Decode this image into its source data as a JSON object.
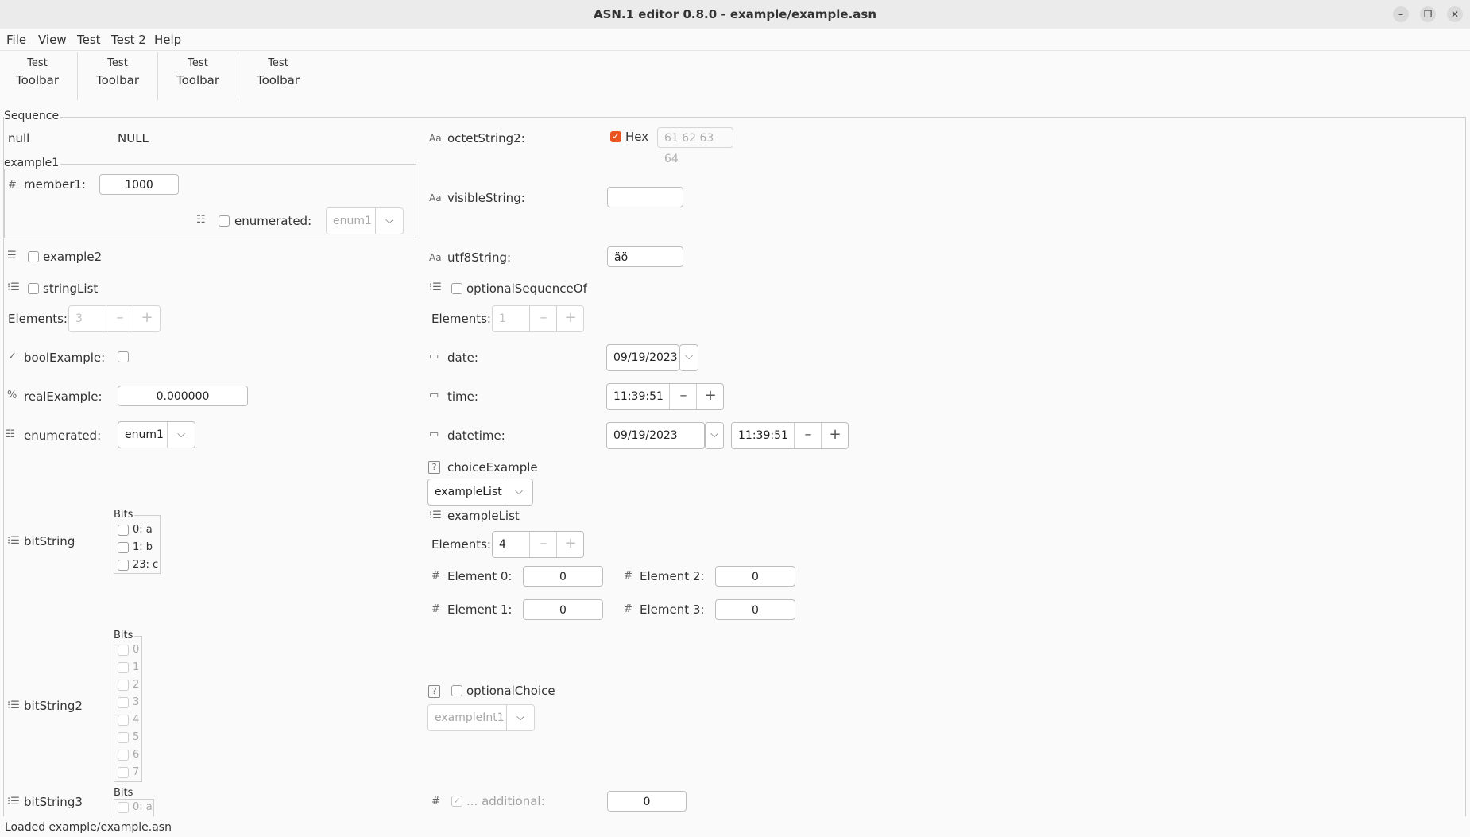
{
  "window": {
    "title": "ASN.1 editor 0.8.0 - example/example.asn",
    "buttons": [
      "minimize-icon",
      "restore-icon",
      "close-icon"
    ]
  },
  "menu": [
    {
      "label": "File"
    },
    {
      "label": "View"
    },
    {
      "label": "Test"
    },
    {
      "label": "Test 2"
    },
    {
      "label": "Help"
    }
  ],
  "toolbar": [
    {
      "top": "Test",
      "bottom": "Toolbar"
    },
    {
      "top": "Test",
      "bottom": "Toolbar"
    },
    {
      "top": "Test",
      "bottom": "Toolbar"
    },
    {
      "top": "Test",
      "bottom": "Toolbar"
    }
  ],
  "sequence": {
    "title": "Sequence",
    "null": {
      "label": "null",
      "value": "NULL"
    },
    "example1": {
      "title": "example1",
      "member1_label": "member1:",
      "member1_value": "1000",
      "enumerated_label": "enumerated:",
      "enumerated_value": "enum1"
    },
    "example2_label": "example2",
    "stringList": {
      "label": "stringList",
      "elements_label": "Elements:",
      "elements_value": "3"
    },
    "boolExample_label": "boolExample:",
    "realExample": {
      "label": "realExample:",
      "value": "0.000000"
    },
    "enumerated": {
      "label": "enumerated:",
      "value": "enum1"
    },
    "bitString": {
      "label": "bitString",
      "bits_title": "Bits",
      "bits": [
        "0: a",
        "1: b",
        "23: c"
      ]
    },
    "bitString2": {
      "label": "bitString2",
      "bits_title": "Bits",
      "bits": [
        "0",
        "1",
        "2",
        "3",
        "4",
        "5",
        "6",
        "7"
      ]
    },
    "bitString3": {
      "label": "bitString3",
      "bits_title": "Bits",
      "bits": [
        "0: a"
      ]
    },
    "octetString2": {
      "label": "octetString2:",
      "hex_label": "Hex",
      "value": "61 62 63 64"
    },
    "visibleString": {
      "label": "visibleString:",
      "value": ""
    },
    "utf8String": {
      "label": "utf8String:",
      "value": "äö"
    },
    "optionalSequenceOf": {
      "label": "optionalSequenceOf",
      "elements_label": "Elements:",
      "elements_value": "1"
    },
    "date": {
      "label": "date:",
      "value": "09/19/2023"
    },
    "time": {
      "label": "time:",
      "value": "11:39:51"
    },
    "datetime": {
      "label": "datetime:",
      "date": "09/19/2023",
      "time": "11:39:51"
    },
    "choiceExample": {
      "label": "choiceExample",
      "selected": "exampleList",
      "exampleList": {
        "label": "exampleList",
        "elements_label": "Elements:",
        "elements_value": "4",
        "items": [
          {
            "label": "Element 0:",
            "value": "0"
          },
          {
            "label": "Element 1:",
            "value": "0"
          },
          {
            "label": "Element 2:",
            "value": "0"
          },
          {
            "label": "Element 3:",
            "value": "0"
          }
        ]
      }
    },
    "optionalChoice": {
      "label": "optionalChoice",
      "selected": "exampleInt1"
    },
    "additional": {
      "label": "... additional:",
      "value": "0"
    }
  },
  "status": "Loaded example/example.asn"
}
